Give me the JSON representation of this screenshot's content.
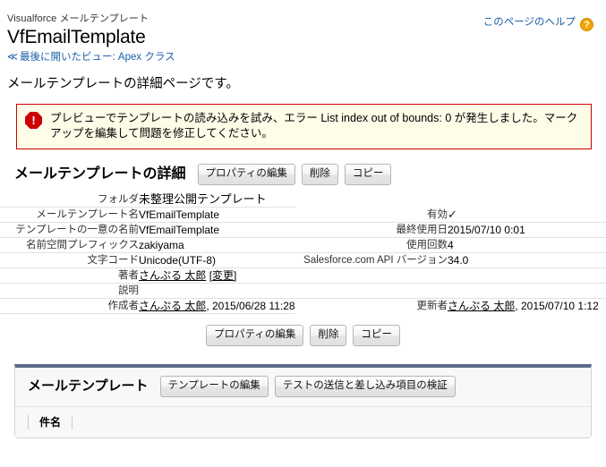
{
  "header": {
    "eyebrow": "Visualforce メールテンプレート",
    "title": "VfEmailTemplate",
    "breadcrumb_chevron": "≪",
    "breadcrumb": "最後に開いたビュー: Apex クラス",
    "help_label": "このページのヘルプ",
    "help_icon": "?",
    "page_description": "メールテンプレートの詳細ページです。"
  },
  "error": {
    "icon": "error-octagon-icon",
    "icon_glyph": "!",
    "message": "プレビューでテンプレートの読み込みを試み、エラー List index out of bounds: 0 が発生しました。マークアップを編集して問題を修正してください。",
    "border_color": "#cc0000",
    "background_color": "#fffce8"
  },
  "detail": {
    "section_title": "メールテンプレートの詳細",
    "buttons": [
      {
        "label": "プロパティの編集",
        "name": "edit-properties-button"
      },
      {
        "label": "削除",
        "name": "delete-button"
      },
      {
        "label": "コピー",
        "name": "copy-button"
      }
    ],
    "rows": [
      {
        "left_label": "フォルダ",
        "left_value": "未整理公開テンプレート",
        "right_label": "",
        "right_value": ""
      },
      {
        "left_label": "メールテンプレート名",
        "left_value": "VfEmailTemplate",
        "right_label": "有効",
        "right_value": "✓"
      },
      {
        "left_label": "テンプレートの一意の名前",
        "left_value": "VfEmailTemplate",
        "right_label": "最終使用日",
        "right_value": "2015/07/10 0:01"
      },
      {
        "left_label": "名前空間プレフィックス",
        "left_value": "zakiyama",
        "right_label": "使用回数",
        "right_value": "4"
      },
      {
        "left_label": "文字コード",
        "left_value": "Unicode(UTF-8)",
        "right_label": "Salesforce.com API バージョン",
        "right_value": "34.0"
      },
      {
        "left_label": "著者",
        "left_value_link": "さんぷる 太郎",
        "left_value_action": "[変更]",
        "right_label": "",
        "right_value": ""
      },
      {
        "left_label": "説明",
        "left_value": "",
        "right_label": "",
        "right_value": ""
      }
    ],
    "created": {
      "label": "作成者",
      "user": "さんぷる 太郎",
      "timestamp": ", 2015/06/28 11:28"
    },
    "updated": {
      "label": "更新者",
      "user": "さんぷる 太郎",
      "timestamp": ", 2015/07/10 1:12"
    }
  },
  "related_list": {
    "title": "メールテンプレート",
    "buttons": [
      {
        "label": "テンプレートの編集",
        "name": "edit-template-button"
      },
      {
        "label": "テストの送信と差し込み項目の検証",
        "name": "send-test-button"
      }
    ],
    "columns": [
      "件名"
    ],
    "accent_color": "#5c6b8a"
  }
}
